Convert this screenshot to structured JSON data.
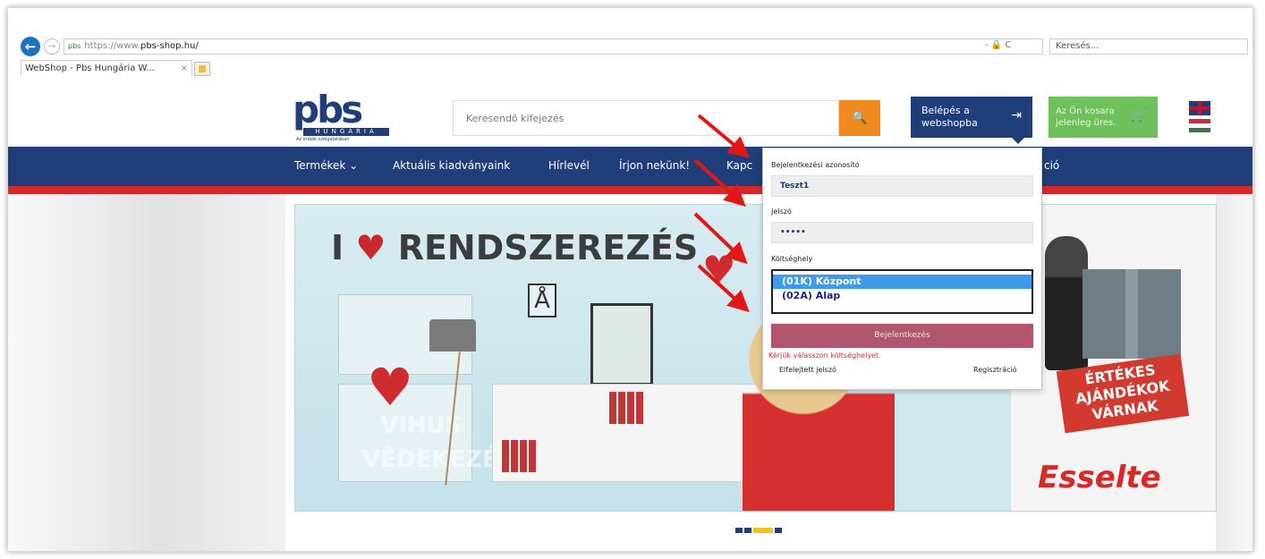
{
  "browser": {
    "back_icon": "back-arrow-icon",
    "url_prefix": "https://www.",
    "url_domain": "pbs-shop.hu/",
    "url_tools": "- 🔒 C",
    "search_placeholder": "Keresés...",
    "tab_title": "WebShop - Pbs Hungária W...",
    "tab_close": "×"
  },
  "header": {
    "logo_text": "pbs",
    "logo_sub": "HUNGÁRIA",
    "logo_tag": "Az irodák szolgálatában",
    "search_placeholder": "Keresendő kifejezés",
    "search_icon": "🔍",
    "login_line1": "Belépés a",
    "login_line2": "webshopba",
    "login_icon": "⇥",
    "cart_line1": "Az Ön kosara",
    "cart_line2": "jelenleg üres.",
    "cart_icon": "🛒"
  },
  "nav": {
    "items": [
      "Termékek ⌄",
      "Aktuális kiadványaink",
      "Hírlevél",
      "Írjon nekünk!",
      "Kapc",
      "ció"
    ]
  },
  "banner": {
    "title_prefix": "I",
    "title_heart": "♥",
    "title_word": "RENDSZEREZÉS",
    "letter": "Å",
    "promo": "ÉRTÉKES AJÁNDÉKOK VÁRNAK",
    "brand": "Esselte",
    "ghost1": "VIHUS",
    "ghost2": "VÉDEKEZÉS"
  },
  "login_panel": {
    "username_label": "Bejelentkezési azonosító",
    "username_value": "Teszt1",
    "password_label": "Jelszó",
    "password_value": "•••••",
    "cost_center_label": "Költséghely",
    "cost_center_options": [
      "(01K) Központ",
      "(02A) Alap"
    ],
    "cost_center_selected": "(01K) Központ",
    "login_button": "Bejelentkezés",
    "error_text": "Kérjük válasszon költséghelyet.",
    "forgot_password": "Elfelejtett jelszó",
    "register": "Regisztráció"
  },
  "carousel": {
    "slides": 4,
    "active": 3
  },
  "colors": {
    "brand_blue": "#1f3e7a",
    "accent_orange": "#ef8a1e",
    "cart_green": "#6dc05a",
    "nav_red": "#d62a2a",
    "login_button": "#b0576d",
    "selected_option": "#3d9be9",
    "annotation_arrows": "#e01818"
  }
}
